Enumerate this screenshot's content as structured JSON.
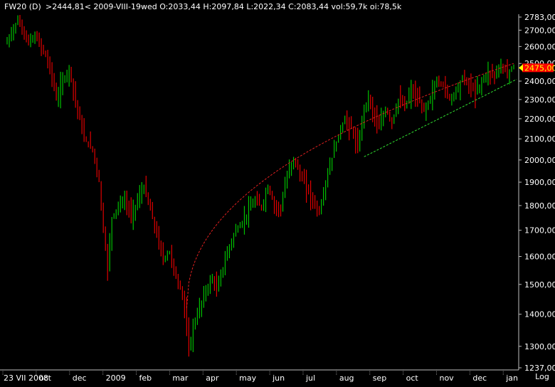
{
  "header": {
    "symbol": "FW20 (D)",
    "info": ">2444,81<  2009-VIII-19wed O:2033,44 H:2097,84 L:2022,34 C:2083,44 vol:59,7k oi:78,5k"
  },
  "colors": {
    "background": "#000000",
    "text": "#ffffff",
    "up_candle": "#00c000",
    "down_candle": "#e00000",
    "resistance_line": "#e02020",
    "support_line": "#30e030",
    "price_marker": "#ff0000",
    "price_marker_text": "#ffff00",
    "axis_line": "#c0c0c0"
  },
  "chart_data": {
    "type": "candlestick",
    "y_scale": "log",
    "ylim": [
      1237,
      2783
    ],
    "y_ticks": [
      {
        "value": 2783,
        "label": "2783,00"
      },
      {
        "value": 2700,
        "label": "2700,00"
      },
      {
        "value": 2600,
        "label": "2600,00"
      },
      {
        "value": 2500,
        "label": "2500,00"
      },
      {
        "value": 2400,
        "label": "2400,00"
      },
      {
        "value": 2300,
        "label": "2300,00"
      },
      {
        "value": 2200,
        "label": "2200,00"
      },
      {
        "value": 2100,
        "label": "2100,00"
      },
      {
        "value": 2000,
        "label": "2000,00"
      },
      {
        "value": 1900,
        "label": "1900,00"
      },
      {
        "value": 1800,
        "label": "1800,00"
      },
      {
        "value": 1700,
        "label": "1700,00"
      },
      {
        "value": 1600,
        "label": "1600,00"
      },
      {
        "value": 1500,
        "label": "1500,00"
      },
      {
        "value": 1400,
        "label": "1400,00"
      },
      {
        "value": 1300,
        "label": "1300,00"
      },
      {
        "value": 1237,
        "label": "1237,00"
      }
    ],
    "x_labels": [
      "23 VII 2008",
      "oct",
      "dec",
      "2009",
      "feb",
      "mar",
      "apr",
      "may",
      "jun",
      "jul",
      "aug",
      "sep",
      "oct",
      "nov",
      "dec",
      "jan"
    ],
    "scale_label": "Log",
    "last_price": {
      "value": 2475,
      "label": "2475,00"
    },
    "close_path": [
      [
        0,
        2620
      ],
      [
        3,
        2720
      ],
      [
        5,
        2760
      ],
      [
        8,
        2680
      ],
      [
        10,
        2620
      ],
      [
        13,
        2660
      ],
      [
        16,
        2600
      ],
      [
        20,
        2480
      ],
      [
        23,
        2300
      ],
      [
        26,
        2400
      ],
      [
        29,
        2470
      ],
      [
        32,
        2290
      ],
      [
        36,
        2100
      ],
      [
        40,
        2050
      ],
      [
        43,
        1900
      ],
      [
        45,
        1700
      ],
      [
        47,
        1560
      ],
      [
        49,
        1750
      ],
      [
        52,
        1800
      ],
      [
        55,
        1820
      ],
      [
        58,
        1760
      ],
      [
        61,
        1820
      ],
      [
        64,
        1880
      ],
      [
        67,
        1780
      ],
      [
        70,
        1680
      ],
      [
        73,
        1590
      ],
      [
        76,
        1620
      ],
      [
        79,
        1520
      ],
      [
        82,
        1470
      ],
      [
        84,
        1350
      ],
      [
        85,
        1290
      ],
      [
        87,
        1360
      ],
      [
        90,
        1420
      ],
      [
        93,
        1480
      ],
      [
        96,
        1520
      ],
      [
        98,
        1480
      ],
      [
        101,
        1560
      ],
      [
        104,
        1640
      ],
      [
        107,
        1700
      ],
      [
        110,
        1730
      ],
      [
        113,
        1780
      ],
      [
        116,
        1820
      ],
      [
        119,
        1790
      ],
      [
        122,
        1880
      ],
      [
        125,
        1800
      ],
      [
        128,
        1790
      ],
      [
        131,
        1930
      ],
      [
        134,
        2010
      ],
      [
        137,
        1930
      ],
      [
        140,
        1880
      ],
      [
        143,
        1820
      ],
      [
        146,
        1770
      ],
      [
        149,
        1900
      ],
      [
        152,
        2010
      ],
      [
        155,
        2120
      ],
      [
        158,
        2200
      ],
      [
        161,
        2150
      ],
      [
        164,
        2050
      ],
      [
        167,
        2260
      ],
      [
        169,
        2310
      ],
      [
        171,
        2240
      ],
      [
        174,
        2150
      ],
      [
        177,
        2250
      ],
      [
        180,
        2180
      ],
      [
        183,
        2300
      ],
      [
        186,
        2260
      ],
      [
        189,
        2350
      ],
      [
        192,
        2300
      ],
      [
        195,
        2240
      ],
      [
        198,
        2310
      ],
      [
        201,
        2400
      ],
      [
        204,
        2380
      ],
      [
        207,
        2300
      ],
      [
        210,
        2350
      ],
      [
        213,
        2420
      ],
      [
        216,
        2380
      ],
      [
        219,
        2340
      ],
      [
        222,
        2400
      ],
      [
        225,
        2450
      ],
      [
        228,
        2440
      ],
      [
        231,
        2480
      ],
      [
        234,
        2460
      ],
      [
        237,
        2470
      ]
    ],
    "overlays": [
      {
        "name": "resistance-arc",
        "style": "dashed",
        "color": "red"
      },
      {
        "name": "support-line",
        "style": "dashed",
        "color": "green"
      }
    ]
  }
}
